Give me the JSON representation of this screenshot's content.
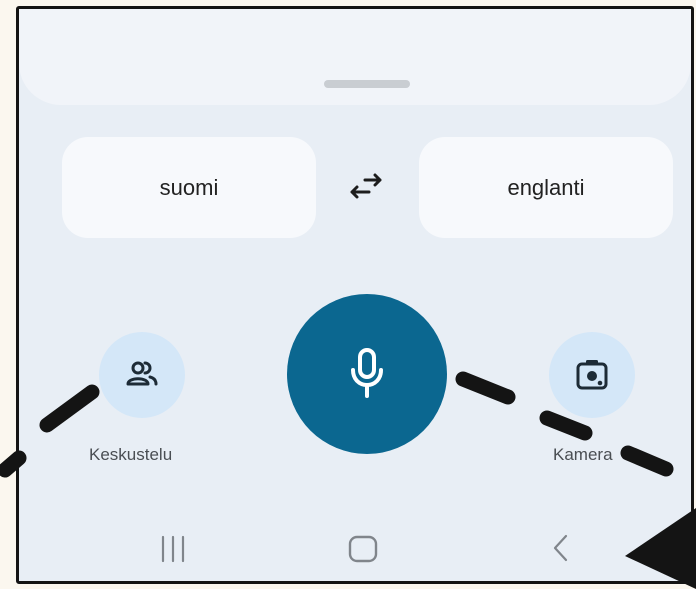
{
  "sheet": {
    "handle": "drag-handle"
  },
  "languages": {
    "source": "suomi",
    "target": "englanti",
    "swap_icon": "swap-arrows-icon"
  },
  "actions": {
    "conversation": {
      "label": "Keskustelu",
      "icon": "people-icon"
    },
    "microphone": {
      "icon": "microphone-icon"
    },
    "camera": {
      "label": "Kamera",
      "icon": "camera-lens-icon"
    }
  },
  "navigation": {
    "recents_icon": "recents-icon",
    "home_icon": "home-icon",
    "back_icon": "back-icon"
  },
  "colors": {
    "mic_background": "#0b6790",
    "side_button_background": "#d4e7f8",
    "page_background": "#e8eef5",
    "annotation_stroke": "#141414"
  }
}
